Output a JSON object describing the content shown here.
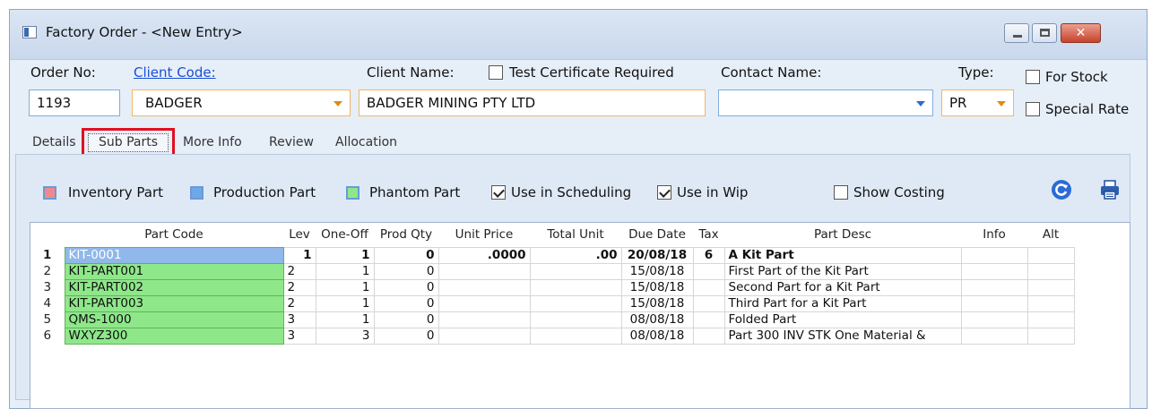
{
  "window": {
    "title": "Factory Order - <New Entry>",
    "controls": {
      "close_glyph": "✕"
    }
  },
  "header": {
    "order_no_label": "Order No:",
    "order_no_value": "1193",
    "client_code_label": "Client Code:",
    "client_code_value": "BADGER",
    "client_name_label": "Client Name:",
    "client_name_value": "BADGER MINING PTY LTD",
    "test_cert_label": "Test Certificate Required",
    "test_cert_checked": false,
    "contact_name_label": "Contact Name:",
    "contact_name_value": "",
    "type_label": "Type:",
    "type_value": "PR",
    "for_stock_label": "For Stock",
    "special_rate_label": "Special Rate"
  },
  "tabs": [
    {
      "label": "Details"
    },
    {
      "label": "Sub Parts",
      "active": true
    },
    {
      "label": "More Info"
    },
    {
      "label": "Review"
    },
    {
      "label": "Allocation"
    }
  ],
  "toolbar": {
    "inventory_part": "Inventory Part",
    "production_part": "Production Part",
    "phantom_part": "Phantom Part",
    "use_in_scheduling": "Use in Scheduling",
    "use_in_scheduling_checked": true,
    "use_in_wip": "Use in Wip",
    "use_in_wip_checked": true,
    "show_costing": "Show Costing",
    "show_costing_checked": false,
    "colors": {
      "inventory": "#f08a8a",
      "production": "#6fa8e8",
      "phantom": "#8ee88a"
    },
    "icons": [
      "refresh-icon",
      "print-icon"
    ]
  },
  "grid": {
    "columns": [
      "",
      "Part Code",
      "Lev",
      "One-Off",
      "Prod Qty",
      "Unit Price",
      "Total Unit",
      "Due Date",
      "Tax",
      "Part Desc",
      "Info",
      "Alt"
    ],
    "rows": [
      {
        "n": "1",
        "code": "KIT-0001",
        "lev": "1",
        "oneoff": "1",
        "prodqty": "0",
        "unitprice": ".0000",
        "totalunit": ".00",
        "due": "20/08/18",
        "tax": "6",
        "desc": "A Kit Part",
        "info": "",
        "alt": ""
      },
      {
        "n": "2",
        "code": "KIT-PART001",
        "lev": "2",
        "oneoff": "1",
        "prodqty": "0",
        "unitprice": "",
        "totalunit": "",
        "due": "15/08/18",
        "tax": "",
        "desc": "First Part of the Kit Part",
        "info": "",
        "alt": ""
      },
      {
        "n": "3",
        "code": "KIT-PART002",
        "lev": "2",
        "oneoff": "1",
        "prodqty": "0",
        "unitprice": "",
        "totalunit": "",
        "due": "15/08/18",
        "tax": "",
        "desc": "Second Part for a Kit Part",
        "info": "",
        "alt": ""
      },
      {
        "n": "4",
        "code": "KIT-PART003",
        "lev": "2",
        "oneoff": "1",
        "prodqty": "0",
        "unitprice": "",
        "totalunit": "",
        "due": "15/08/18",
        "tax": "",
        "desc": "Third Part for a Kit Part",
        "info": "",
        "alt": ""
      },
      {
        "n": "5",
        "code": "QMS-1000",
        "lev": "3",
        "oneoff": "1",
        "prodqty": "0",
        "unitprice": "",
        "totalunit": "",
        "due": "08/08/18",
        "tax": "",
        "desc": "Folded Part",
        "info": "",
        "alt": ""
      },
      {
        "n": "6",
        "code": "WXYZ300",
        "lev": "3",
        "oneoff": "3",
        "prodqty": "0",
        "unitprice": "",
        "totalunit": "",
        "due": "08/08/18",
        "tax": "",
        "desc": "Part 300 INV  STK One Material &",
        "info": "",
        "alt": ""
      }
    ]
  }
}
